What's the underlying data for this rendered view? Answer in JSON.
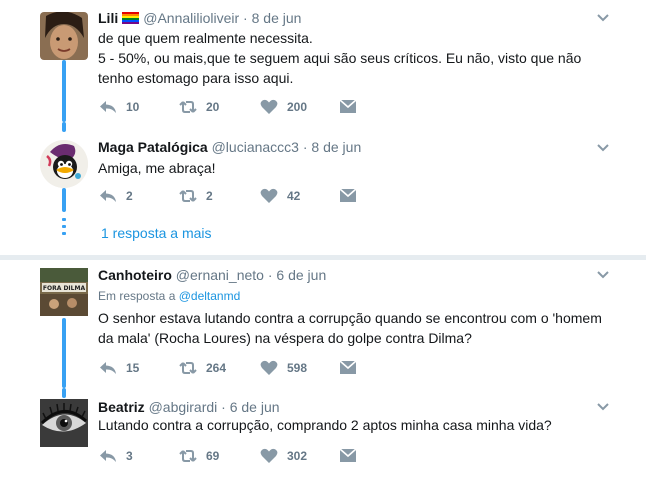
{
  "tweets": [
    {
      "name": "Lili",
      "handle": "@Annalilioliveir",
      "separator": "·",
      "time": "8 de jun",
      "text": "de que quem realmente necessita.\n5 - 50%, ou mais,que te seguem aqui são seus críticos. Eu não, visto que não tenho estomago para isso aqui.",
      "replies": "10",
      "retweets": "20",
      "likes": "200",
      "has_flag": true
    },
    {
      "name": "Maga Patalógica",
      "handle": "@lucianaccc3",
      "separator": "·",
      "time": "8 de jun",
      "text": "Amiga, me abraça!",
      "replies": "2",
      "retweets": "2",
      "likes": "42"
    },
    {
      "name": "Canhoteiro",
      "handle": "@ernani_neto",
      "separator": "·",
      "time": "6 de jun",
      "reply_prefix": "Em resposta a",
      "reply_mention": "@deltanmd",
      "text": "O senhor estava lutando contra a corrupção quando se encontrou com o 'homem da mala' (Rocha Loures) na véspera do golpe contra Dilma?",
      "replies": "15",
      "retweets": "264",
      "likes": "598"
    },
    {
      "name": "Beatriz",
      "handle": "@abgirardi",
      "separator": "·",
      "time": "6 de jun",
      "text": "Lutando contra a corrupção, comprando 2 aptos minha casa minha vida?",
      "replies": "3",
      "retweets": "69",
      "likes": "302"
    }
  ],
  "more_replies_label": "1 resposta a mais",
  "avatar_labels": {
    "canhoteiro": "FORA DILMA"
  },
  "colors": {
    "link": "#1b95e0",
    "thread": "#38a1f3",
    "muted": "#657786",
    "background": "#e6ecf0"
  },
  "icons": [
    "reply-icon",
    "retweet-icon",
    "like-icon",
    "direct-message-icon",
    "caret-down-icon",
    "rainbow-flag-icon"
  ]
}
